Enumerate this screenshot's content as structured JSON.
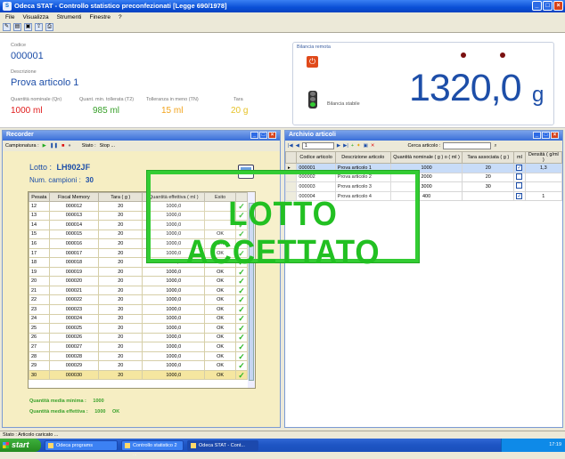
{
  "window": {
    "title": "Odeca STAT  -  Controllo statistico preconfezionati  [Legge 690/1978]"
  },
  "menu": [
    "File",
    "Visualizza",
    "Strumenti",
    "Finestre",
    "?"
  ],
  "header": {
    "codice_label": "Codice",
    "codice": "000001",
    "descr_label": "Descrizione",
    "descr": "Prova articolo 1",
    "qn_label": "Quantità nominale (Qn)",
    "qn": "1000 ml",
    "qmin_label": "Quant. min. tollerata (T2)",
    "qmin": "985 ml",
    "tol_label": "Tolleranza in meno (TN)",
    "tol": "15 ml",
    "tara_label": "Tara",
    "tara": "20 g"
  },
  "scale": {
    "title": "Bilancia remota",
    "status": "Bilancia stabile",
    "value": "1320,0",
    "unit": "g"
  },
  "recorder": {
    "title": "Recorder",
    "toolbar_label": "Campionatura :",
    "stato": "Stato :",
    "stato_val": "Stop ...",
    "lotto_label": "Lotto :",
    "lotto": "LH902JF",
    "num_label": "Num. campioni :",
    "num": "30",
    "columns": [
      "Pesata",
      "Fiscal Memory",
      "Tara ( g )",
      "Quantità effettiva ( ml )",
      "Esito"
    ],
    "rows": [
      [
        "12",
        "000012",
        "20",
        "1000,0",
        ""
      ],
      [
        "13",
        "000013",
        "20",
        "1000,0",
        ""
      ],
      [
        "14",
        "000014",
        "20",
        "1000,0",
        ""
      ],
      [
        "15",
        "000015",
        "20",
        "1000,0",
        "OK"
      ],
      [
        "16",
        "000016",
        "20",
        "1000,0",
        "OK"
      ],
      [
        "17",
        "000017",
        "20",
        "1000,0",
        "OK"
      ],
      [
        "18",
        "000018",
        "20",
        "1000,0",
        "OK"
      ],
      [
        "19",
        "000019",
        "20",
        "1000,0",
        "OK"
      ],
      [
        "20",
        "000020",
        "20",
        "1000,0",
        "OK"
      ],
      [
        "21",
        "000021",
        "20",
        "1000,0",
        "OK"
      ],
      [
        "22",
        "000022",
        "20",
        "1000,0",
        "OK"
      ],
      [
        "23",
        "000023",
        "20",
        "1000,0",
        "OK"
      ],
      [
        "24",
        "000024",
        "20",
        "1000,0",
        "OK"
      ],
      [
        "25",
        "000025",
        "20",
        "1000,0",
        "OK"
      ],
      [
        "26",
        "000026",
        "20",
        "1000,0",
        "OK"
      ],
      [
        "27",
        "000027",
        "20",
        "1000,0",
        "OK"
      ],
      [
        "28",
        "000028",
        "20",
        "1000,0",
        "OK"
      ],
      [
        "29",
        "000029",
        "20",
        "1000,0",
        "OK"
      ],
      [
        "30",
        "000030",
        "20",
        "1000,0",
        "OK"
      ]
    ],
    "min_label": "Quantità media minima :",
    "min_val": "1000",
    "eff_label": "Quantità media effettiva :",
    "eff_val": "1000",
    "eff_ok": "OK"
  },
  "archivio": {
    "title": "Archivio articoli",
    "nav_value": "1",
    "search_label": "Cerca articolo :",
    "columns": [
      "Codice articolo",
      "Descrizione articolo",
      "Quantità nominale ( g ) o ( ml )",
      "Tara associata ( g )",
      "ml",
      "Densità ( g/ml )"
    ],
    "rows": [
      [
        "000001",
        "Prova articolo 1",
        "1000",
        "20",
        true,
        "1,3"
      ],
      [
        "000002",
        "Prova articolo 2",
        "2000",
        "20",
        false,
        ""
      ],
      [
        "000003",
        "Prova articolo 3",
        "3000",
        "30",
        false,
        ""
      ],
      [
        "000004",
        "Prova articolo 4",
        "400",
        "",
        true,
        "1"
      ]
    ]
  },
  "stamp": "LOTTO  ACCETTATO",
  "status": "Stato :   Articolo caricato ...",
  "taskbar": {
    "start": "start",
    "tasks": [
      "Odeca programs",
      "Controllo statistico 2 ...",
      "Odeca STAT  -  Cont..."
    ],
    "clock": "17:19"
  },
  "colors": {
    "accent": "#1d4ea8",
    "ok_green": "#2db824",
    "qmin_green": "#3aa12c",
    "tol_orange": "#f2a31b",
    "tara_yellow": "#e6c229",
    "red": "#e01c1c"
  }
}
